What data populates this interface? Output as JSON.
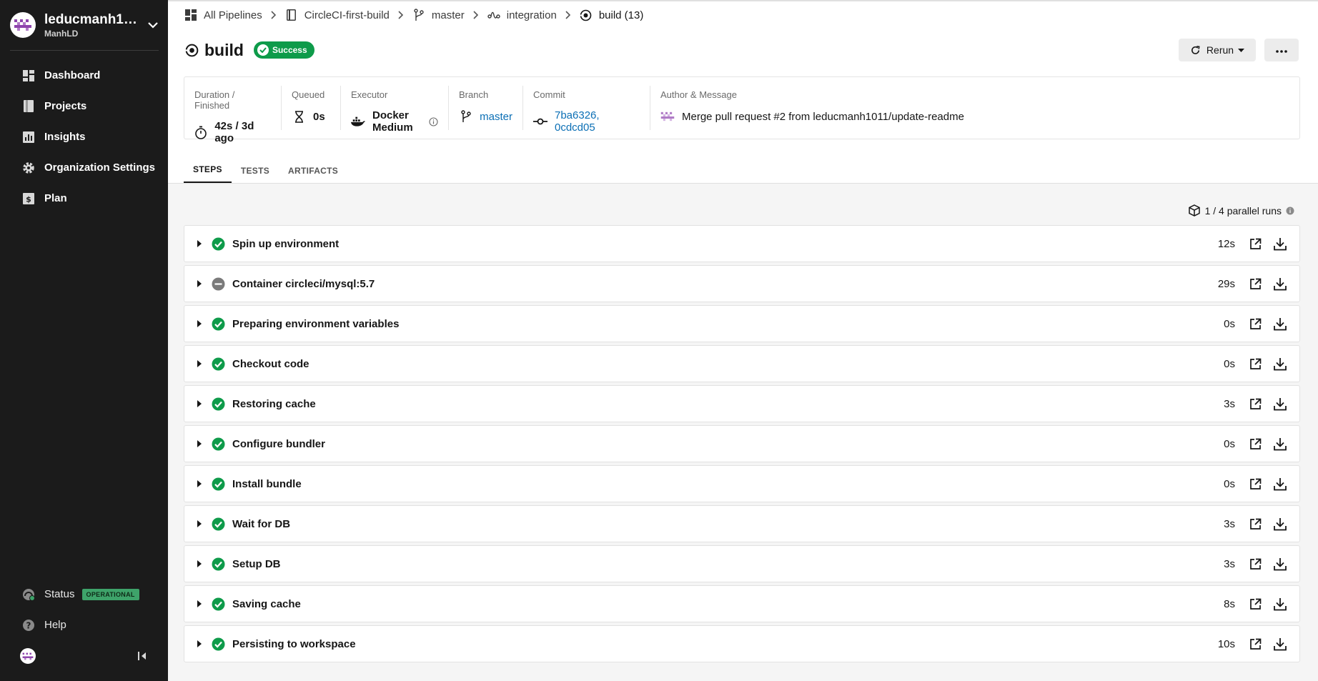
{
  "sidebar": {
    "org_name": "leducmanh10...",
    "org_sub": "ManhLD",
    "nav": [
      {
        "label": "Dashboard",
        "icon": "dashboard-icon"
      },
      {
        "label": "Projects",
        "icon": "projects-icon"
      },
      {
        "label": "Insights",
        "icon": "insights-icon"
      },
      {
        "label": "Organization Settings",
        "icon": "gear-icon"
      },
      {
        "label": "Plan",
        "icon": "dollar-icon"
      }
    ],
    "status_label": "Status",
    "status_badge": "OPERATIONAL",
    "help_label": "Help"
  },
  "breadcrumb": {
    "all_pipelines": "All Pipelines",
    "project": "CircleCI-first-build",
    "branch": "master",
    "workflow": "integration",
    "job": "build (13)"
  },
  "header": {
    "title": "build",
    "status": "Success",
    "rerun_label": "Rerun"
  },
  "info": {
    "duration_label": "Duration / Finished",
    "duration_value": "42s / 3d ago",
    "queued_label": "Queued",
    "queued_value": "0s",
    "executor_label": "Executor",
    "executor_value": "Docker Medium",
    "branch_label": "Branch",
    "branch_value": "master",
    "commit_label": "Commit",
    "commit_value": "7ba6326, 0cdcd05",
    "author_label": "Author & Message",
    "author_value": "Merge pull request #2 from leducmanh1011/update-readme"
  },
  "tabs": [
    "STEPS",
    "TESTS",
    "ARTIFACTS"
  ],
  "parallel_runs": "1 / 4 parallel runs",
  "steps": [
    {
      "name": "Spin up environment",
      "duration": "12s",
      "status": "success"
    },
    {
      "name": "Container circleci/mysql:5.7",
      "duration": "29s",
      "status": "neutral"
    },
    {
      "name": "Preparing environment variables",
      "duration": "0s",
      "status": "success"
    },
    {
      "name": "Checkout code",
      "duration": "0s",
      "status": "success"
    },
    {
      "name": "Restoring cache",
      "duration": "3s",
      "status": "success"
    },
    {
      "name": "Configure bundler",
      "duration": "0s",
      "status": "success"
    },
    {
      "name": "Install bundle",
      "duration": "0s",
      "status": "success"
    },
    {
      "name": "Wait for DB",
      "duration": "3s",
      "status": "success"
    },
    {
      "name": "Setup DB",
      "duration": "3s",
      "status": "success"
    },
    {
      "name": "Saving cache",
      "duration": "8s",
      "status": "success"
    },
    {
      "name": "Persisting to workspace",
      "duration": "10s",
      "status": "success"
    }
  ],
  "colors": {
    "sidebar_bg": "#1b1b1b",
    "success": "#0e9b4a",
    "link": "#0b6fb5",
    "operational": "#3ea36a",
    "neutral": "#7a7a7a"
  }
}
